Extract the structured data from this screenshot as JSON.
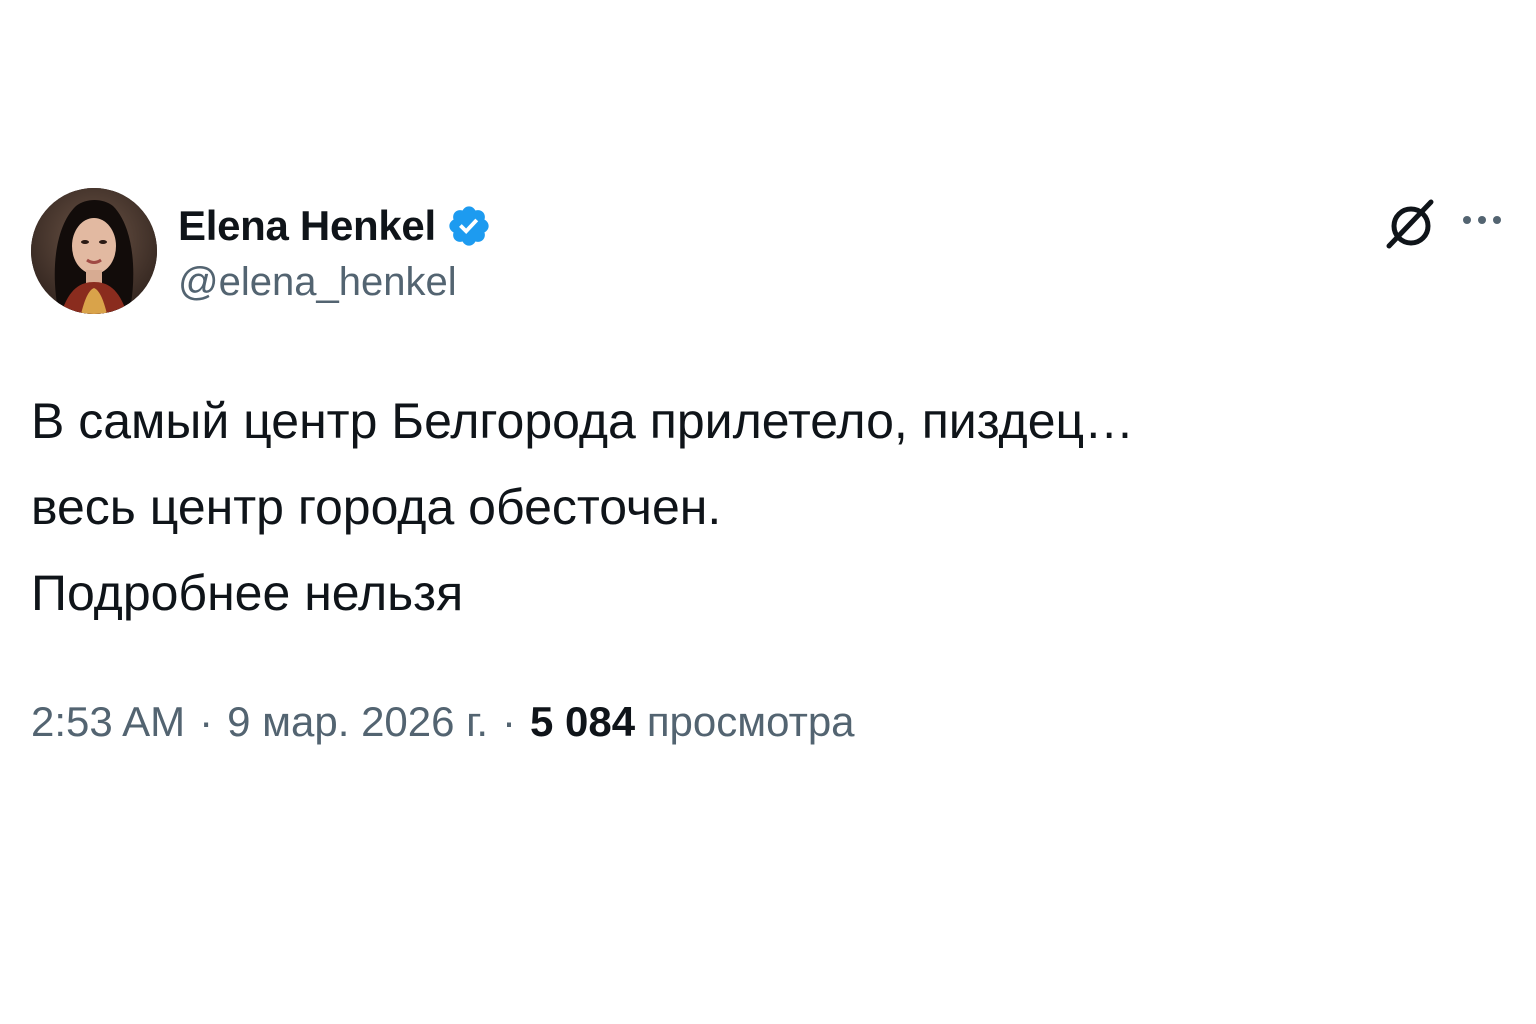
{
  "author": {
    "name": "Elena Henkel",
    "handle": "@elena_henkel",
    "verified": true,
    "verified_color": "#1d9bf0"
  },
  "tweet": {
    "lines": [
      "В самый центр Белгорода прилетело, пиздец…",
      "весь центр города обесточен.",
      "Подробнее нельзя"
    ]
  },
  "meta": {
    "time": "2:53 AM",
    "separator": "·",
    "date": "9 мар. 2026 г.",
    "views_count": "5 084",
    "views_label": "просмотра"
  },
  "icons": {
    "grok": "grok-icon",
    "more": "more-icon",
    "verified": "verified-badge-icon"
  },
  "colors": {
    "text_primary": "#0f1419",
    "text_secondary": "#536471",
    "accent": "#1d9bf0",
    "background": "#ffffff"
  }
}
